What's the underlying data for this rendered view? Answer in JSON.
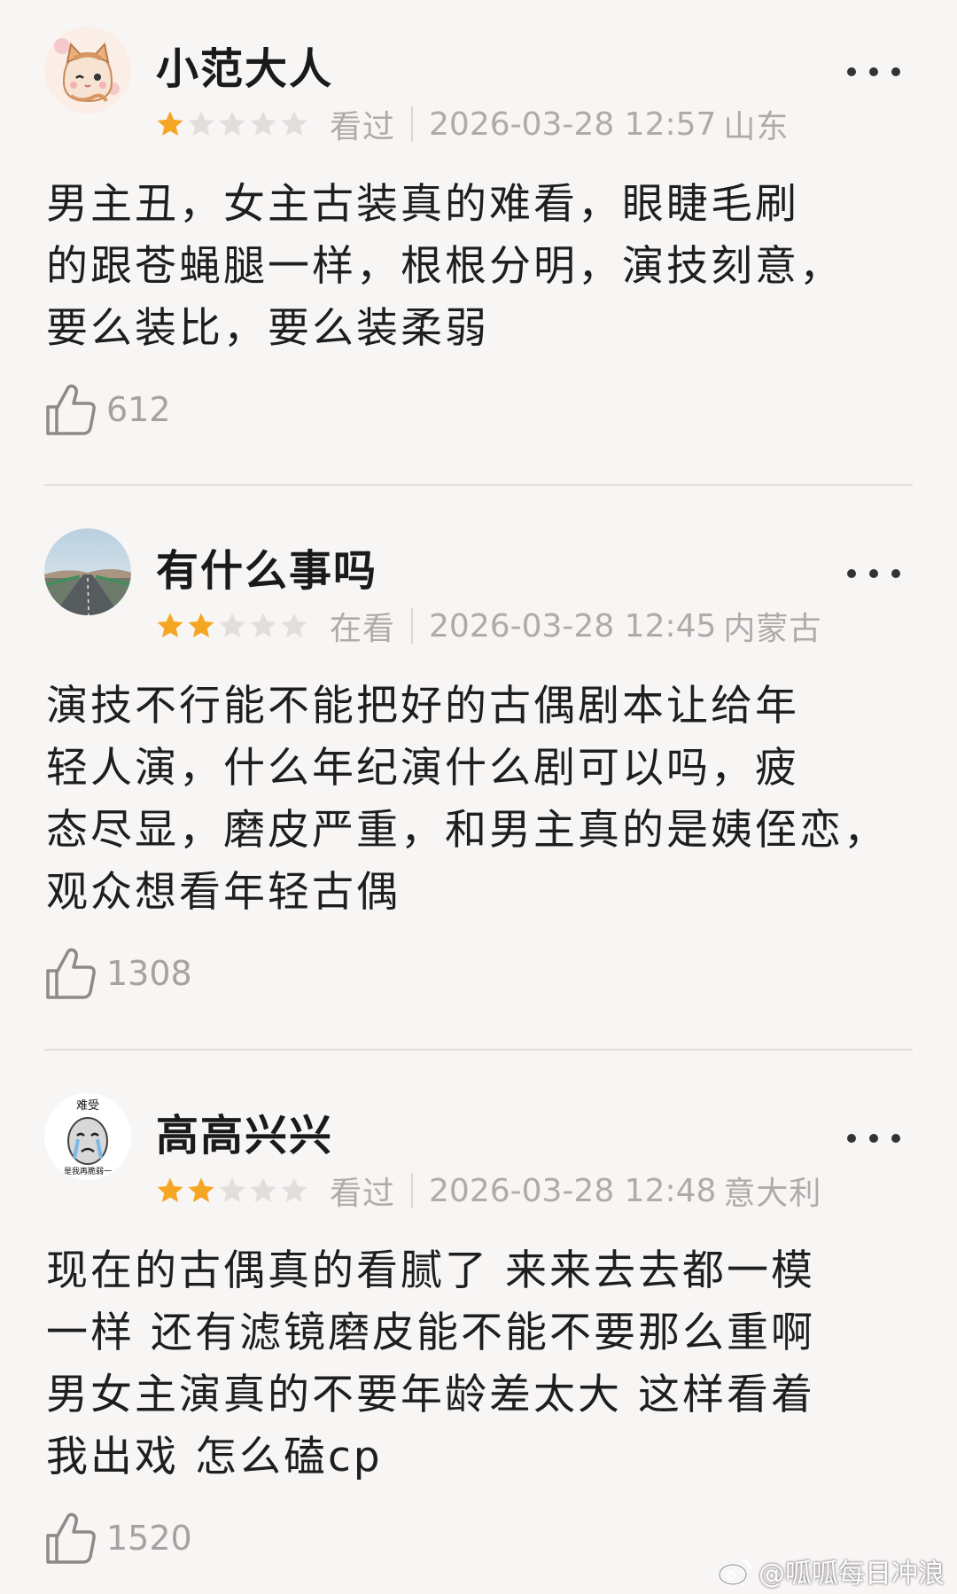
{
  "reviews": [
    {
      "username": "小范大人",
      "rating": 1,
      "max_rating": 5,
      "status": "看过",
      "datetime": "2026-03-28 12:57",
      "location": "山东",
      "content_lines": [
        "男主丑，女主古装真的难看，眼睫毛刷",
        "的跟苍蝇腿一样，根根分明，演技刻意，",
        "要么装比，要么装柔弱"
      ],
      "likes": "612",
      "avatar_icon": "cat-avatar-icon"
    },
    {
      "username": "有什么事吗",
      "rating": 2,
      "max_rating": 5,
      "status": "在看",
      "datetime": "2026-03-28 12:45",
      "location": "内蒙古",
      "content_lines": [
        "演技不行能不能把好的古偶剧本让给年",
        "轻人演，什么年纪演什么剧可以吗，疲",
        "态尽显，磨皮严重，和男主真的是姨侄恋，",
        "观众想看年轻古偶"
      ],
      "likes": "1308",
      "avatar_icon": "road-landscape-avatar-icon"
    },
    {
      "username": "高高兴兴",
      "rating": 2,
      "max_rating": 5,
      "status": "看过",
      "datetime": "2026-03-28 12:48",
      "location": "意大利",
      "content_lines": [
        "现在的古偶真的看腻了 来来去去都一模",
        "一样 还有滤镜磨皮能不能不要那么重啊",
        "男女主演真的不要年龄差太大 这样看着",
        "我出戏 怎么磕cp"
      ],
      "likes": "1520",
      "avatar_icon": "crying-meme-avatar-icon",
      "avatar_text_top": "难受",
      "avatar_text_bottom": "是我再脆弱一"
    }
  ],
  "watermark": {
    "text": "@呱呱每日冲浪",
    "icon": "weibo-logo-icon"
  },
  "colors": {
    "background": "#f8f5f5",
    "star_filled": "#f5a623",
    "star_empty": "#e3dede",
    "meta_text": "#b0aaaa",
    "divider": "#e4dfdf"
  }
}
